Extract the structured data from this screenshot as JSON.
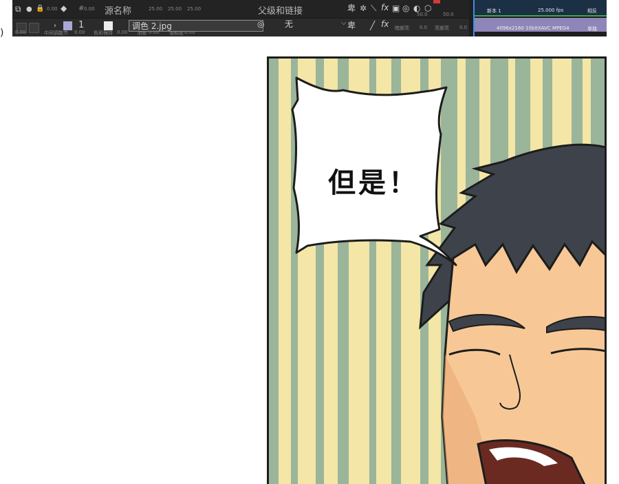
{
  "timeline": {
    "header": {
      "source_name_label": "源名称",
      "parent_link_label": "父级和链接",
      "small_values": [
        "0.00",
        "0.00",
        "25.00",
        "25.00",
        "25.00"
      ],
      "hash": "#"
    },
    "layer": {
      "index": "1",
      "name": "调色 2.jpg",
      "parent_value": "无",
      "label_color": "#a9a8d4"
    },
    "under_labels": [
      "中间调能节",
      "色彩保持",
      "阴影",
      "高光",
      "饱和度"
    ],
    "under_values": [
      "0.00",
      "0.00",
      "0.00",
      "0.00",
      "0.00"
    ],
    "mid_values": [
      "50.0",
      "50.0",
      "0.0",
      "0.0"
    ],
    "mid_labels": [
      "暗部亮",
      "亮部亮"
    ],
    "graph": {
      "comp_name": "新本 1",
      "fps": "25.000 fps",
      "quality": "相反",
      "size_info": "4096x2160 10bit",
      "codec": "XAVC MPEG4",
      "mode": "单独"
    }
  },
  "comic": {
    "speech_text": "但是！",
    "colors": {
      "stripe_yellow": "#f3e6a6",
      "stripe_green": "#9ab59a",
      "hair": "#3e434b",
      "skin": "#f7c896",
      "outline": "#1c1c1c"
    }
  }
}
